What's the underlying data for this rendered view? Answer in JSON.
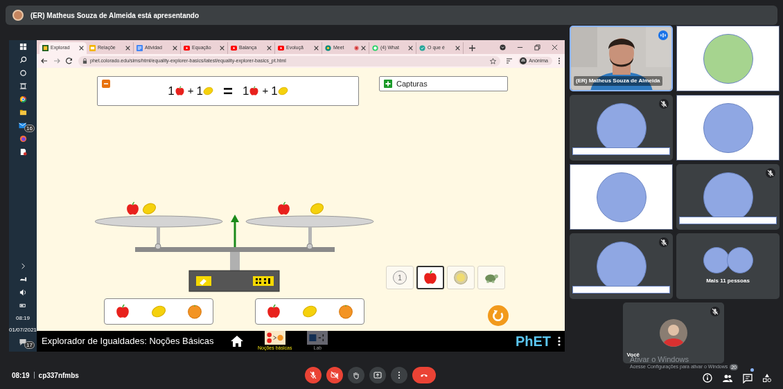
{
  "presenter_banner": {
    "text": "(ER) Matheus Souza de Almeida está apresentando"
  },
  "taskbar": {
    "mail_badge": "16",
    "time": "08:19",
    "date": "01/07/2021",
    "notification_badge": "17"
  },
  "browser": {
    "tabs": [
      {
        "label": "Explorad",
        "kind": "phet",
        "selected": true,
        "recording": false
      },
      {
        "label": "Relaçõe",
        "kind": "slides",
        "selected": false,
        "recording": false
      },
      {
        "label": "Atividad",
        "kind": "docs",
        "selected": false,
        "recording": false
      },
      {
        "label": "Equação",
        "kind": "youtube",
        "selected": false,
        "recording": false
      },
      {
        "label": "Balança",
        "kind": "youtube",
        "selected": false,
        "recording": false
      },
      {
        "label": "Evoluçã",
        "kind": "youtube",
        "selected": false,
        "recording": false
      },
      {
        "label": "Meet",
        "kind": "meet",
        "selected": false,
        "recording": true
      },
      {
        "label": "(4) What",
        "kind": "whatsapp",
        "selected": false,
        "recording": false
      },
      {
        "label": "O que é",
        "kind": "site",
        "selected": false,
        "recording": false
      }
    ],
    "url": "phet.colorado.edu/sims/html/equality-explorer-basics/latest/equality-explorer-basics_pt.html",
    "profile": "Anónima"
  },
  "sim": {
    "equation": [
      {
        "kind": "apple",
        "text": "1"
      },
      {
        "kind": "operator",
        "text": "+"
      },
      {
        "kind": "lemon",
        "text": "1"
      },
      {
        "kind": "equals",
        "text": "="
      },
      {
        "kind": "apple",
        "text": "1"
      },
      {
        "kind": "operator",
        "text": "+"
      },
      {
        "kind": "lemon",
        "text": "1"
      }
    ],
    "snapshots_button": {
      "label": "Capturas"
    },
    "left_pan": [
      {
        "kind": "apple"
      },
      {
        "kind": "lemon"
      }
    ],
    "right_pan": [
      {
        "kind": "apple"
      },
      {
        "kind": "lemon"
      }
    ],
    "toolbox": [
      {
        "kind": "number",
        "text": "1",
        "selected": false
      },
      {
        "kind": "apple",
        "selected": true
      },
      {
        "kind": "coin",
        "selected": false
      },
      {
        "kind": "turtle",
        "selected": false
      }
    ],
    "item_panels": [
      {
        "items": [
          {
            "kind": "apple"
          },
          {
            "kind": "lemon"
          },
          {
            "kind": "orange"
          }
        ]
      },
      {
        "items": [
          {
            "kind": "apple"
          },
          {
            "kind": "lemon"
          },
          {
            "kind": "orange"
          }
        ]
      }
    ]
  },
  "navbar": {
    "title": "Explorador de Igualdades: Noções Básicas",
    "screens": [
      {
        "label": "Noções básicas",
        "kind": "basics",
        "selected": true
      },
      {
        "label": "Lab",
        "kind": "lab",
        "selected": false
      }
    ],
    "logo": "PhET"
  },
  "participants": [
    {
      "kind": "video",
      "framed": false,
      "name": "(ER) Matheus Souza de Almeida",
      "speaking": true
    },
    {
      "kind": "avatar",
      "framed": true,
      "color": "#a6d48f",
      "muted": false,
      "name_bar": false
    },
    {
      "kind": "avatar",
      "framed": false,
      "color": "#8fa7e3",
      "muted": true,
      "name_bar": true
    },
    {
      "kind": "avatar",
      "framed": true,
      "color": "#8fa7e3",
      "muted": false,
      "name_bar": false
    },
    {
      "kind": "avatar",
      "framed": true,
      "color": "#8fa7e3",
      "muted": false,
      "name_bar": false
    },
    {
      "kind": "avatar",
      "framed": false,
      "color": "#8fa7e3",
      "muted": true,
      "name_bar": true
    },
    {
      "kind": "avatar",
      "framed": false,
      "color": "#8fa7e3",
      "muted": true,
      "name_bar": true
    },
    {
      "kind": "more",
      "framed": false,
      "text": "Mais 11 pessoas"
    },
    {
      "kind": "self",
      "framed": false,
      "name": "Você",
      "muted": true
    }
  ],
  "meeting": {
    "time": "08:19",
    "code": "cp337nfmbs",
    "mic_on": false,
    "camera_on": false,
    "people_count": "20",
    "chat_unread": true
  },
  "activation_notice": {
    "title": "Ativar o Windows",
    "text": "Acesse Configurações para ativar o Windows"
  }
}
